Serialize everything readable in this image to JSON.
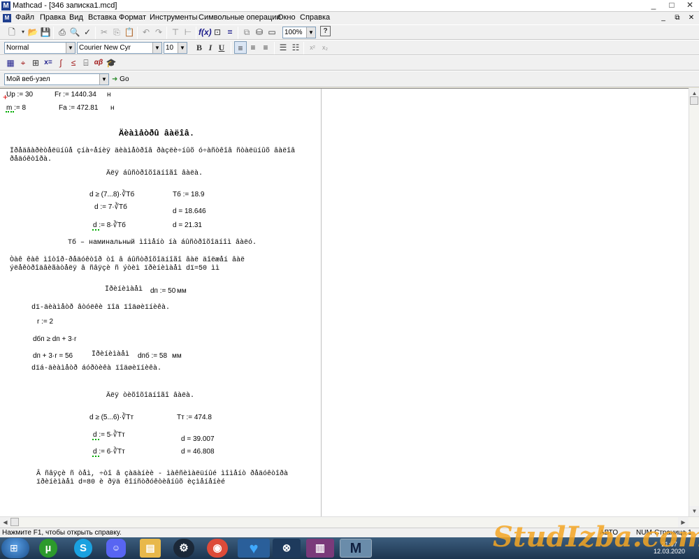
{
  "window": {
    "title": "Mathcad - [346 записка1.mcd]",
    "app_icon": "M"
  },
  "menu": [
    "Файл",
    "Правка",
    "Вид",
    "Вставка",
    "Формат",
    "Инструменты",
    "Символьные операции",
    "Окно",
    "Справка"
  ],
  "toolbar": {
    "zoom": "100%",
    "go_label": "Go",
    "help": "?"
  },
  "format_bar": {
    "style": "Normal",
    "font": "Courier New Cyr",
    "size": "10",
    "bold": "B",
    "italic": "I",
    "underline": "U",
    "sup": "x²",
    "sub": "x₂"
  },
  "math_bar": {
    "eq": "x=",
    "alpha": "αβ"
  },
  "web_bar": {
    "url": "Мой веб-узел"
  },
  "document": {
    "up": "Up := 30",
    "fr": "Fr := 1440.34",
    "fr_unit": "н",
    "m": "m := 8",
    "fa": "Fa := 472.81",
    "fa_unit": "н",
    "heading": "Äèàìåòðû âàëîâ.",
    "p1_l1": "Ïðåäâàðèòåëüíûå çíà÷åíèÿ äèàìåòðîâ ðàçëè÷íûõ ó÷àñòêîâ ñòàëüíûõ âàëîâ",
    "p1_l2": "ðåäóêòîðà.",
    "sub_fast": "Äëÿ áûñòðîõîäíîãî âàëà.",
    "f1": "d ≥ (7...8)·∛Tб",
    "tb": "Tб := 18.9",
    "f2": "d := 7·∛Tб",
    "f3": "d = 18.646",
    "f4": "d := 8·∛Tб",
    "f5": "d = 21.31",
    "tb_note": "Тб – наминальный ìîìåíò íà áûñòðîõîäíîì âàëó.",
    "p2_l1": "Òàê êàê ìîòîð-ðåäóêòîð òî â áûñòðîõîäíîãî âàë äîëæåí âàë",
    "p2_l2": "ýëåêòðîäâèãàòåëÿ â ñâÿçè ñ ýòèì ïðèíèìàåì dï=50 ìì",
    "prinimaem1": "Ïðèíèìàåì",
    "dp": "dп := 50",
    "dp_unit": "мм",
    "p3": "dï-äèàìåòð âòóëêè ïîä ïîäøèïíèêà.",
    "r": "r := 2",
    "dbp": "dбп ≥ dп + 3·r",
    "dp3r": "dп + 3·r = 56",
    "prinimaem2": "Ïðèíèìàåì",
    "dbp2": "dпб := 58",
    "dbp2_unit": "мм",
    "p4": "dïá-äèàìåòð áóðòèêà ïîäøèïíèêà.",
    "sub_slow": "Äëÿ òèõîõîäíîãî âàëà.",
    "g1": "d ≥ (5...6)·∛Tт",
    "tt": "Tт := 474.8",
    "g2": "d := 5·∛Tт",
    "g3": "d = 39.007",
    "g4": "d := 6·∛Tт",
    "g5": "d = 46.808",
    "p5_l1": "Â ñâÿçè ñ òåì, ÷òî â çàäàíèè - ìàêñèìàëüíûé ìîìåíò ðåäóêòîðà",
    "p5_l2": "ïðèíèìàåì d=80 è ðÿä êîíñòðóêòèâíûõ èçìåíåíèé"
  },
  "status": {
    "help": "Нажмите F1, чтобы открыть справку.",
    "mode": "АВТО",
    "num": "NUM",
    "page": "Страница 1"
  },
  "taskbar": {
    "time": "21:57",
    "date": "12.03.2020"
  },
  "watermark": "StudIzba.com"
}
